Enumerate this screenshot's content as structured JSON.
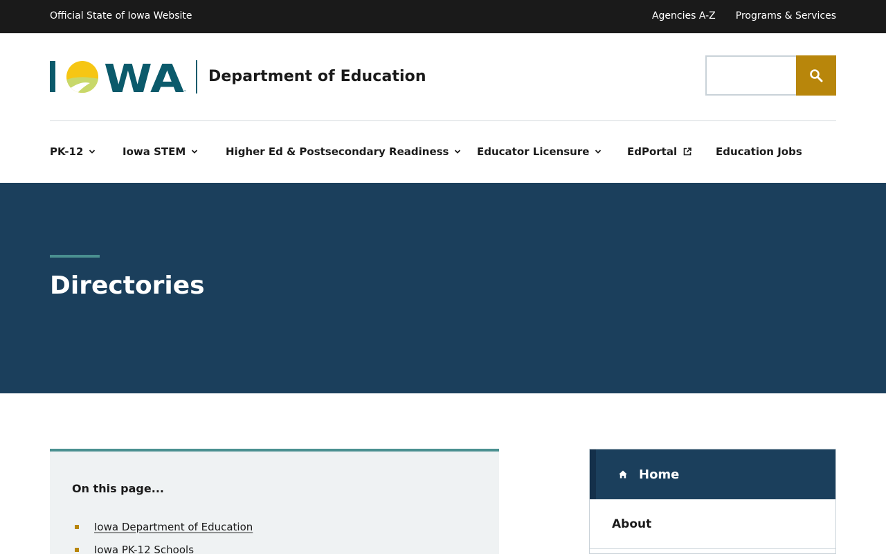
{
  "topbar": {
    "official": "Official State of Iowa Website",
    "links": [
      "Agencies A-Z",
      "Programs & Services"
    ]
  },
  "header": {
    "logo_text": "IOWA",
    "department": "Department of Education",
    "search": {
      "placeholder": "",
      "icon": "search-icon"
    }
  },
  "nav": {
    "items": [
      {
        "label": "PK-12",
        "icon": "chevron-down-icon"
      },
      {
        "label": "Iowa STEM",
        "icon": "chevron-down-icon"
      },
      {
        "label": "Higher Ed & Postsecondary Readiness",
        "icon": "chevron-down-icon"
      },
      {
        "label": "Educator Licensure",
        "icon": "chevron-down-icon"
      },
      {
        "label": "EdPortal",
        "icon": "external-link-icon"
      },
      {
        "label": "Education Jobs"
      }
    ]
  },
  "hero": {
    "title": "Directories"
  },
  "onpage": {
    "heading": "On this page...",
    "links": [
      "Iowa Department of Education",
      "Iowa PK-12 Schools"
    ]
  },
  "sidenav": {
    "home": "Home",
    "about": "About"
  },
  "colors": {
    "topbar": "#1a1a1a",
    "hero": "#1b3f5c",
    "accent_teal": "#4a9090",
    "accent_gold": "#b8860b",
    "logo_teal": "#0b5a6b"
  }
}
